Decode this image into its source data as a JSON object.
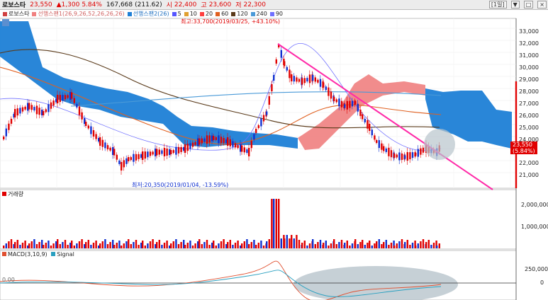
{
  "topbar": {
    "name": "로보스타",
    "price": "23,550",
    "change": "▲1,300",
    "change_pct": "5.84%",
    "volume": "167,668",
    "amount": "(211.62)",
    "open_label": "시",
    "open": "22,400",
    "high_label": "고",
    "high": "23,600",
    "low_label": "저",
    "low": "22,300",
    "period": "[1일]",
    "buttons": [
      "▼",
      "□",
      "×"
    ]
  },
  "legend": {
    "item1": "로보스타",
    "item2": "선행스팬1(26,9,26,52,26,26,26)",
    "item3": "선행스팬2(26)",
    "ma": [
      "5",
      "10",
      "20",
      "60",
      "120",
      "240",
      "90"
    ],
    "colors": {
      "span1": "#f08080",
      "span2": "#1e7fd6",
      "ma5": "#5555ff",
      "ma10": "#e0a030",
      "ma20": "#ff4040",
      "ma60": "#e06020",
      "ma120": "#5a3a1a",
      "ma240": "#4a9ad8",
      "ma90": "#7070ff"
    }
  },
  "annotations": {
    "high": "최고:33,700(2019/03/25, +43.10%)",
    "low": "최저:20,350(2019/01/04, -13.59%)",
    "current_price": "23,550",
    "current_pct": "(5.84%)"
  },
  "price_axis": [
    "33,000",
    "32,000",
    "31,000",
    "30,000",
    "29,000",
    "28,000",
    "27,000",
    "26,000",
    "25,000",
    "24,000",
    "22,000",
    "21,000"
  ],
  "volume_panel": {
    "label": "거래량",
    "axis": [
      "2,000,000",
      "1,000,000"
    ]
  },
  "macd_panel": {
    "label": "MACD(3,10,9)",
    "signal": "Signal",
    "left_value": "0.00",
    "axis": [
      "250,000",
      "0"
    ]
  },
  "colors": {
    "up": "#e00000",
    "down": "#1030d0",
    "trendline": "#ff2aa8",
    "cloud_blue": "#1e7fd6",
    "cloud_red": "#f08080",
    "highlight": "#b8c4cc"
  }
}
